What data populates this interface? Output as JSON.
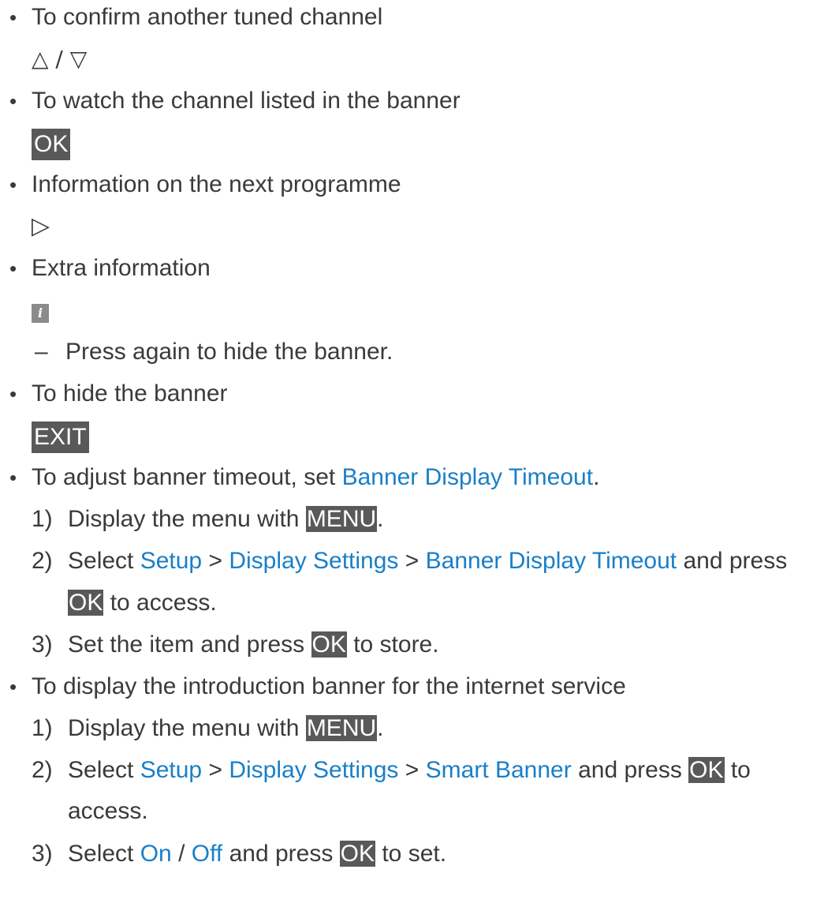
{
  "items": [
    {
      "text": "To confirm another tuned channel",
      "keys": "△ / ▽"
    },
    {
      "text": "To watch the channel listed in the banner",
      "key": "OK"
    },
    {
      "text": "Information on the next programme",
      "icon": "triangle-right-icon",
      "glyph": "▷"
    },
    {
      "text": "Extra information",
      "icon": "info-icon",
      "glyph": "i",
      "note": "Press again to hide the banner."
    },
    {
      "text": "To hide the banner",
      "key": "EXIT"
    }
  ],
  "timeout": {
    "intro": "To adjust banner timeout, set ",
    "intro_link": "Banner Display Timeout",
    "intro_end": ".",
    "steps": [
      {
        "num": "1)",
        "pre": "Display the menu with ",
        "key": "MENU",
        "post": "."
      },
      {
        "num": "2)",
        "pre": "Select ",
        "l1": "Setup",
        "sep1": " > ",
        "l2": "Display Settings",
        "sep2": " > ",
        "l3": "Banner Display Timeout",
        "post": " and press",
        "key": "OK",
        "post2": " to access."
      },
      {
        "num": "3)",
        "pre": "Set the item and press ",
        "key": "OK",
        "post": " to store."
      }
    ]
  },
  "smart": {
    "intro": "To display the introduction banner for the internet service",
    "steps": [
      {
        "num": "1)",
        "pre": "Display the menu with ",
        "key": "MENU",
        "post": "."
      },
      {
        "num": "2)",
        "pre": "Select ",
        "l1": "Setup",
        "sep1": " > ",
        "l2": "Display Settings",
        "sep2": " > ",
        "l3": "Smart Banner",
        "post": " and press ",
        "key": "OK",
        "post2": " to",
        "cont": "access."
      },
      {
        "num": "3)",
        "pre": "Select ",
        "l1": "On",
        "sep1": " / ",
        "l2": "Off",
        "post": " and press ",
        "key": "OK",
        "post2": " to set."
      }
    ]
  },
  "colors": {
    "link": "#1a7fc8",
    "key_bg": "#595959",
    "text": "#3a3a3a"
  }
}
